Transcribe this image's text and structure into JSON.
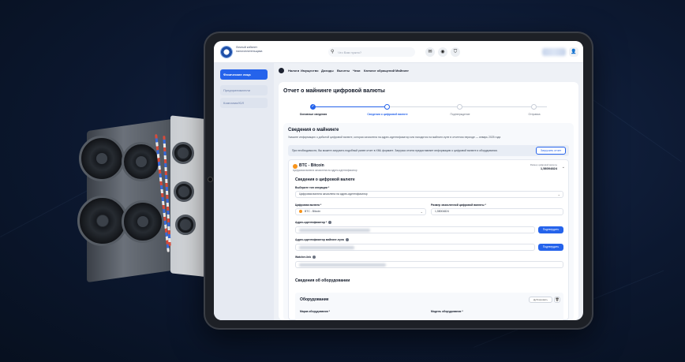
{
  "header": {
    "org_name": "Личный кабинет налогоплательщика",
    "search_placeholder": "Что Вам нужно?"
  },
  "sidebar": {
    "items": [
      {
        "label": "Физические лица"
      },
      {
        "label": "Предприниматели"
      },
      {
        "label": "Компании/ЮЛ"
      }
    ]
  },
  "topnav": {
    "items": [
      "Налоги",
      "Имущество",
      "Доходы",
      "Вычеты",
      "Чеки",
      "Каталог обращений",
      "Майнинг"
    ]
  },
  "main": {
    "title": "Отчет о майнинге цифровой валюты",
    "steps": [
      {
        "label": "Основные сведения",
        "state": "done"
      },
      {
        "label": "Сведения о цифровой валюте",
        "state": "current"
      },
      {
        "label": "Подтверждение",
        "state": "todo"
      },
      {
        "label": "Отправка",
        "state": "todo"
      }
    ],
    "section_title": "Сведения о майнинге",
    "section_desc": "Укажите информацию о добытой цифровой валюте, которая зачислена на адрес-идентификатор или находится на майнинг-пуле в отчетном периоде — январь 2025 года",
    "info_text": "При необходимости, Вы можете загрузить подобный ранее отчет в XML формате. Загрузка отчета предоставляет информацию о цифровой валюте и оборудовании.",
    "upload_button": "Загрузить отчет"
  },
  "coin": {
    "name": "BTC - Bitcoin",
    "subtitle": "Цифровая валюта зачислена на адрес-идентификатор",
    "amount_label": "Размер цифровой валюты",
    "amount": "1,58004824",
    "currency_section": "Сведения о цифровой валюте",
    "op_type_label": "Выберите тип операции *",
    "op_type_value": "Цифровая валюта зачислена на адрес-идентификатор",
    "currency_label": "Цифровая валюта *",
    "currency_value": "BTC - Bitcoin",
    "size_label": "Размер зачисленной цифровой валюты *",
    "size_value": "1,58004824",
    "address_label": "Адрес-идентификатор *",
    "pool_label": "Адрес-идентификатор майнинг-пула",
    "watcher_label": "Watcher-link",
    "confirm_label": "Подтвердить",
    "equipment_section": "Сведения об оборудовании",
    "equipment_title": "Оборудование",
    "duplicate_button": "Дублировать",
    "brand_label": "Марка оборудования *",
    "model_label": "Модель оборудования *"
  },
  "colors": {
    "accent": "#2563eb",
    "bitcoin": "#f7931a",
    "background": "#0c1830"
  }
}
